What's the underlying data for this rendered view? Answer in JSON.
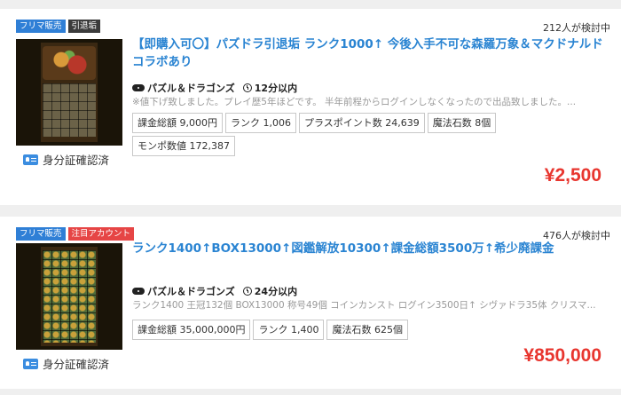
{
  "listings": [
    {
      "badges": [
        "フリマ販売",
        "引退垢"
      ],
      "badge_colors": [
        "#2f7fd6",
        "#3b3b3b"
      ],
      "watchers": "212人が検討中",
      "title": "【即購入可〇】パズドラ引退垢 ランク1000↑ 今後入手不可な森羅万象＆マクドナルドコラボあり",
      "game": "パズル＆ドラゴンズ",
      "time": "12分以内",
      "description": "※値下げ致しました。プレイ歴5年ほどです。 半年前程からログインしなくなったので出品致しました。...",
      "tags": [
        "課金総額 9,000円",
        "ランク 1,006",
        "プラスポイント数 24,639",
        "魔法石数 8個",
        "モンポ数値 172,387"
      ],
      "id_verified": "身分証確認済",
      "price": "¥2,500"
    },
    {
      "badges": [
        "フリマ販売",
        "注目アカウント"
      ],
      "badge_colors": [
        "#2f7fd6",
        "#e64545"
      ],
      "watchers": "476人が検討中",
      "title": "ランク1400↑BOX13000↑図鑑解放10300↑課金総額3500万↑希少廃課金",
      "game": "パズル＆ドラゴンズ",
      "time": "24分以内",
      "description": "ランク1400 王冠132個 BOX13000 称号49個 コインカンスト ログイン3500日↑ シヴァドラ35体 クリスマ...",
      "tags": [
        "課金総額 35,000,000円",
        "ランク 1,400",
        "魔法石数 625個"
      ],
      "id_verified": "身分証確認済",
      "price": "¥850,000"
    }
  ],
  "colors": {
    "accent": "#2a84d2",
    "price": "#e8362f",
    "background": "#efefef"
  }
}
